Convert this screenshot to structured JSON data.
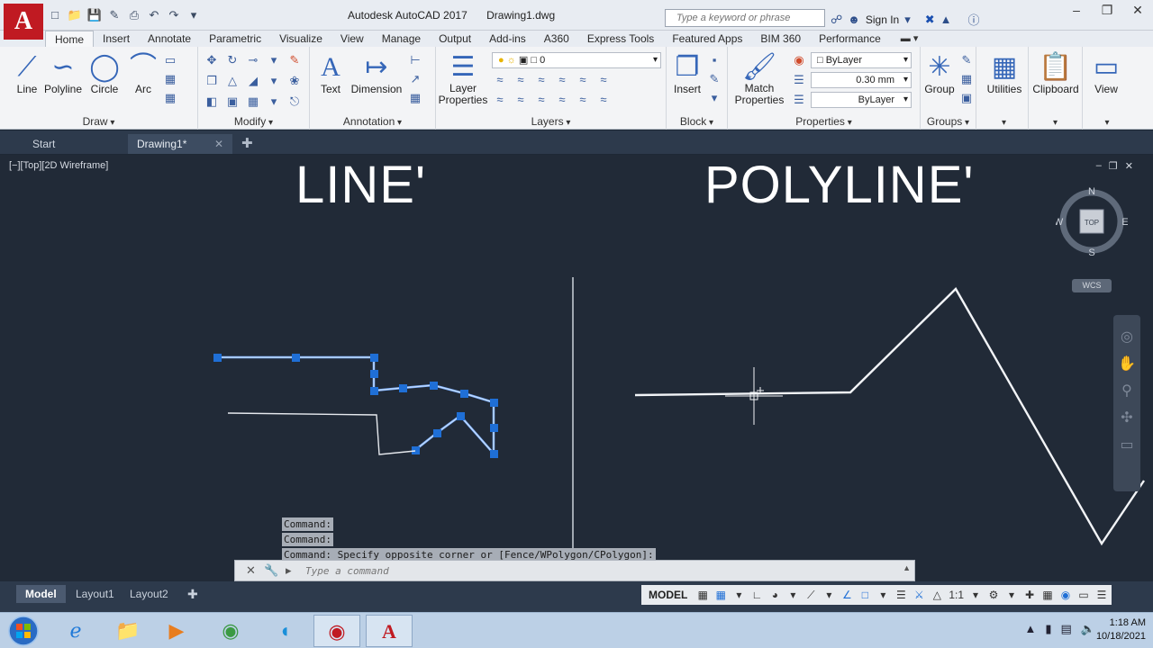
{
  "app": {
    "logo_letter": "A",
    "title": "Autodesk AutoCAD 2017",
    "document": "Drawing1.dwg"
  },
  "search": {
    "placeholder": "Type a keyword or phrase"
  },
  "account": {
    "signin": "Sign In"
  },
  "ribbon_tabs": [
    "Home",
    "Insert",
    "Annotate",
    "Parametric",
    "Visualize",
    "View",
    "Manage",
    "Output",
    "Add-ins",
    "A360",
    "Express Tools",
    "Featured Apps",
    "BIM 360",
    "Performance"
  ],
  "panels": {
    "draw": {
      "title": "Draw",
      "line": "Line",
      "polyline": "Polyline",
      "circle": "Circle",
      "arc": "Arc"
    },
    "modify": {
      "title": "Modify"
    },
    "annotation": {
      "title": "Annotation",
      "text": "Text",
      "dimension": "Dimension"
    },
    "layers": {
      "title": "Layers",
      "layer_properties_1": "Layer",
      "layer_properties_2": "Properties",
      "current_layer": "0"
    },
    "block": {
      "title": "Block",
      "insert": "Insert"
    },
    "properties": {
      "title": "Properties",
      "match_1": "Match",
      "match_2": "Properties",
      "color": "ByLayer",
      "lineweight": "0.30 mm",
      "linetype": "ByLayer"
    },
    "groups": {
      "title": "Groups",
      "group": "Group"
    },
    "utilities": {
      "label": "Utilities"
    },
    "clipboard": {
      "label": "Clipboard"
    },
    "view": {
      "label": "View"
    }
  },
  "file_tabs": {
    "start": "Start",
    "drawing": "Drawing1*"
  },
  "viewport": {
    "label": "[−][Top][2D Wireframe]",
    "heading_left": "LINE'",
    "heading_right": "POLYLINE'",
    "viewcube": {
      "n": "N",
      "s": "S",
      "e": "E",
      "w": "W",
      "face": "TOP",
      "wcs": "WCS"
    }
  },
  "command": {
    "history": [
      "Command:",
      "Command:",
      "Command: Specify opposite corner or [Fence/WPolygon/CPolygon]:"
    ],
    "placeholder": "Type a command"
  },
  "layout_tabs": [
    "Model",
    "Layout1",
    "Layout2"
  ],
  "status": {
    "model": "MODEL",
    "scale": "1:1"
  },
  "clock": {
    "time": "1:18 AM",
    "date": "10/18/2021"
  },
  "colors": {
    "brand": "#c01a22",
    "canvas": "#212a37",
    "grip": "#1f6fd6",
    "highlight": "#7fb2ff"
  }
}
